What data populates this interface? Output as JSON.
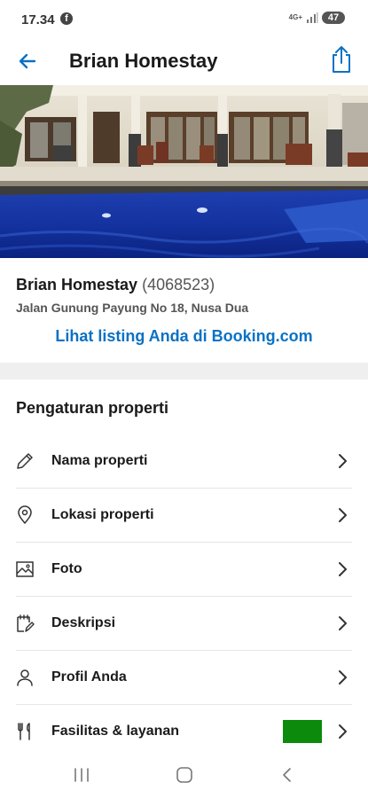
{
  "status_bar": {
    "time": "17.34",
    "fb_icon": "f",
    "network": "4G+",
    "battery": "47"
  },
  "header": {
    "title": "Brian Homestay"
  },
  "property": {
    "name": "Brian Homestay",
    "id": "(4068523)",
    "address": "Jalan Gunung Payung No 18, Nusa Dua",
    "link_label": "Lihat listing Anda di Booking.com"
  },
  "settings": {
    "title": "Pengaturan properti",
    "items": [
      {
        "label": "Nama properti",
        "icon": "pencil-icon"
      },
      {
        "label": "Lokasi properti",
        "icon": "location-pin-icon"
      },
      {
        "label": "Foto",
        "icon": "image-icon"
      },
      {
        "label": "Deskripsi",
        "icon": "notepad-icon"
      },
      {
        "label": "Profil Anda",
        "icon": "user-icon"
      },
      {
        "label": "Fasilitas & layanan",
        "icon": "fork-knife-icon"
      }
    ]
  },
  "colors": {
    "accent": "#0a71c4",
    "badge": "#0b8a0b"
  }
}
